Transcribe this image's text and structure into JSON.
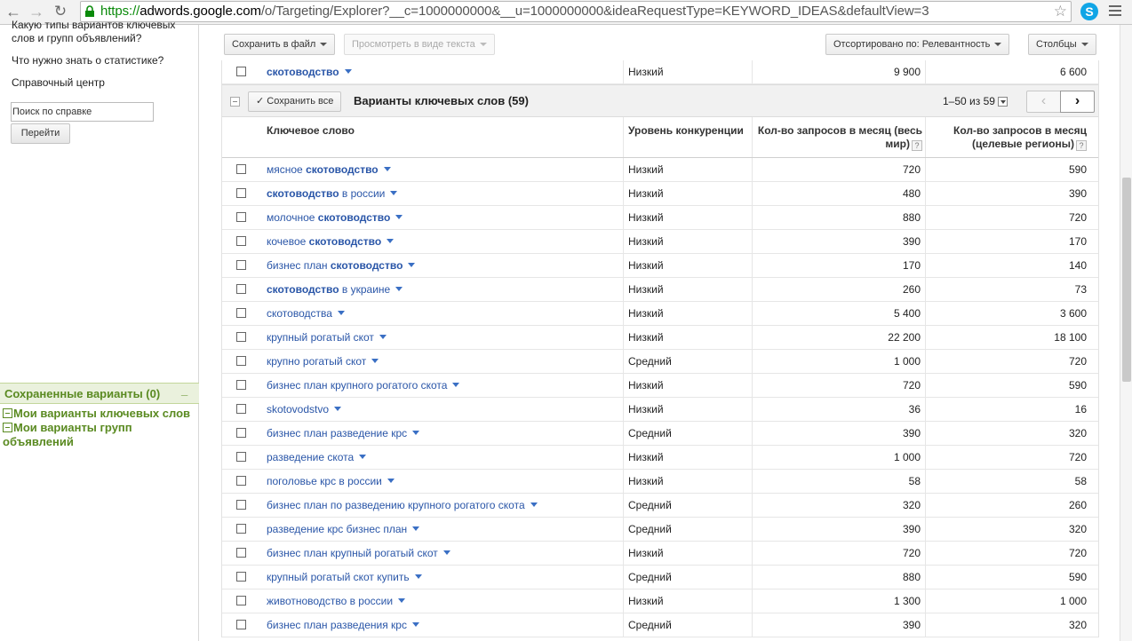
{
  "browser": {
    "url_scheme": "https://",
    "url_host": "adwords.google.com",
    "url_rest": "/o/Targeting/Explorer?__c=1000000000&__u=1000000000&ideaRequestType=KEYWORD_IDEAS&defaultView=3"
  },
  "sidebar": {
    "link_top_line1": "Какую типы вариантов ключевых",
    "link_top_line2": "слов и групп объявлений?",
    "link_stats": "Что нужно знать о статистике?",
    "link_help": "Справочный центр",
    "search_value": "Поиск по справке",
    "go_label": "Перейти",
    "saved_title": "Сохраненные варианты (0)",
    "saved_min": "_",
    "tree_keywords": "Мои варианты ключевых слов",
    "tree_groups_line1": "Мои варианты групп",
    "tree_groups_line2": "объявлений"
  },
  "toolbar": {
    "save_file": "Сохранить в файл",
    "view_text": "Просмотреть в виде текста",
    "sorted_by": "Отсортировано по: Релевантность",
    "columns": "Столбцы"
  },
  "top_row": {
    "keyword": "скотоводство",
    "competition": "Низкий",
    "worldwide": "9 900",
    "local": "6 600"
  },
  "group": {
    "save_all": "Сохранить все",
    "title": "Варианты ключевых слов (59)",
    "pager": "1–50 из 59",
    "prev": "‹",
    "next": "›"
  },
  "headers": {
    "keyword": "Ключевое слово",
    "competition": "Уровень конкуренции",
    "worldwide_line1": "Кол-во запросов в месяц (весь",
    "worldwide_line2": "мир)",
    "local_line1": "Кол-во запросов в месяц",
    "local_line2": "(целевые регионы)",
    "help": "?"
  },
  "rows": [
    {
      "pre": "мясное ",
      "bold": "скотоводство",
      "post": "",
      "competition": "Низкий",
      "worldwide": "720",
      "local": "590"
    },
    {
      "pre": "",
      "bold": "скотоводство",
      "post": " в россии",
      "competition": "Низкий",
      "worldwide": "480",
      "local": "390"
    },
    {
      "pre": "молочное ",
      "bold": "скотоводство",
      "post": "",
      "competition": "Низкий",
      "worldwide": "880",
      "local": "720"
    },
    {
      "pre": "кочевое ",
      "bold": "скотоводство",
      "post": "",
      "competition": "Низкий",
      "worldwide": "390",
      "local": "170"
    },
    {
      "pre": "бизнес план ",
      "bold": "скотоводство",
      "post": "",
      "competition": "Низкий",
      "worldwide": "170",
      "local": "140"
    },
    {
      "pre": "",
      "bold": "скотоводство",
      "post": " в украине",
      "competition": "Низкий",
      "worldwide": "260",
      "local": "73"
    },
    {
      "pre": "скотоводства",
      "bold": "",
      "post": "",
      "competition": "Низкий",
      "worldwide": "5 400",
      "local": "3 600"
    },
    {
      "pre": "крупный рогатый скот",
      "bold": "",
      "post": "",
      "competition": "Низкий",
      "worldwide": "22 200",
      "local": "18 100"
    },
    {
      "pre": "крупно рогатый скот",
      "bold": "",
      "post": "",
      "competition": "Средний",
      "worldwide": "1 000",
      "local": "720"
    },
    {
      "pre": "бизнес план крупного рогатого скота",
      "bold": "",
      "post": "",
      "competition": "Низкий",
      "worldwide": "720",
      "local": "590"
    },
    {
      "pre": "skotovodstvo",
      "bold": "",
      "post": "",
      "competition": "Низкий",
      "worldwide": "36",
      "local": "16"
    },
    {
      "pre": "бизнес план разведение крс",
      "bold": "",
      "post": "",
      "competition": "Средний",
      "worldwide": "390",
      "local": "320"
    },
    {
      "pre": "разведение скота",
      "bold": "",
      "post": "",
      "competition": "Низкий",
      "worldwide": "1 000",
      "local": "720"
    },
    {
      "pre": "поголовье крс в россии",
      "bold": "",
      "post": "",
      "competition": "Низкий",
      "worldwide": "58",
      "local": "58"
    },
    {
      "pre": "бизнес план по разведению крупного рогатого скота",
      "bold": "",
      "post": "",
      "competition": "Средний",
      "worldwide": "320",
      "local": "260"
    },
    {
      "pre": "разведение крс бизнес план",
      "bold": "",
      "post": "",
      "competition": "Средний",
      "worldwide": "390",
      "local": "320"
    },
    {
      "pre": "бизнес план крупный рогатый скот",
      "bold": "",
      "post": "",
      "competition": "Низкий",
      "worldwide": "720",
      "local": "720"
    },
    {
      "pre": "крупный рогатый скот купить",
      "bold": "",
      "post": "",
      "competition": "Средний",
      "worldwide": "880",
      "local": "590"
    },
    {
      "pre": "животноводство в россии",
      "bold": "",
      "post": "",
      "competition": "Низкий",
      "worldwide": "1 300",
      "local": "1 000"
    },
    {
      "pre": "бизнес план разведения крс",
      "bold": "",
      "post": "",
      "competition": "Средний",
      "worldwide": "390",
      "local": "320"
    }
  ],
  "colors": {
    "link": "#2a56a8",
    "saved_green": "#5a8a21"
  },
  "icons": [
    "back-icon",
    "forward-icon",
    "reload-icon",
    "lock-icon",
    "star-icon",
    "skype-icon",
    "menu-icon"
  ]
}
